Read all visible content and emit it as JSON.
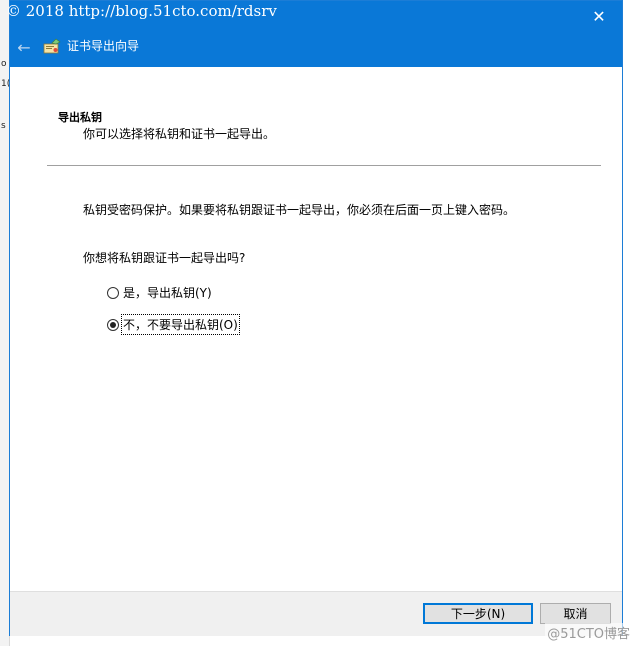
{
  "watermark": "© 2018 http://blog.51cto.com/rdsrv",
  "left_strip": {
    "fragments": [
      "o",
      "1(",
      "s"
    ]
  },
  "titlebar": {
    "title": "证书导出向导",
    "close_glyph": "✕",
    "back_glyph": "←"
  },
  "section": {
    "heading": "导出私钥",
    "subheading": "你可以选择将私钥和证书一起导出。"
  },
  "body_text": "私钥受密码保护。如果要将私钥跟证书一起导出，你必须在后面一页上键入密码。",
  "question": "你想将私钥跟证书一起导出吗?",
  "options": [
    {
      "label": "是，导出私钥(Y)",
      "selected": false
    },
    {
      "label": "不，不要导出私钥(O)",
      "selected": true
    }
  ],
  "buttons": {
    "next": "下一步(N)",
    "cancel": "取消"
  },
  "corner_mark": "@51CTO博客",
  "colors": {
    "titlebar": "#0a78d7",
    "accent": "#0078d7"
  }
}
